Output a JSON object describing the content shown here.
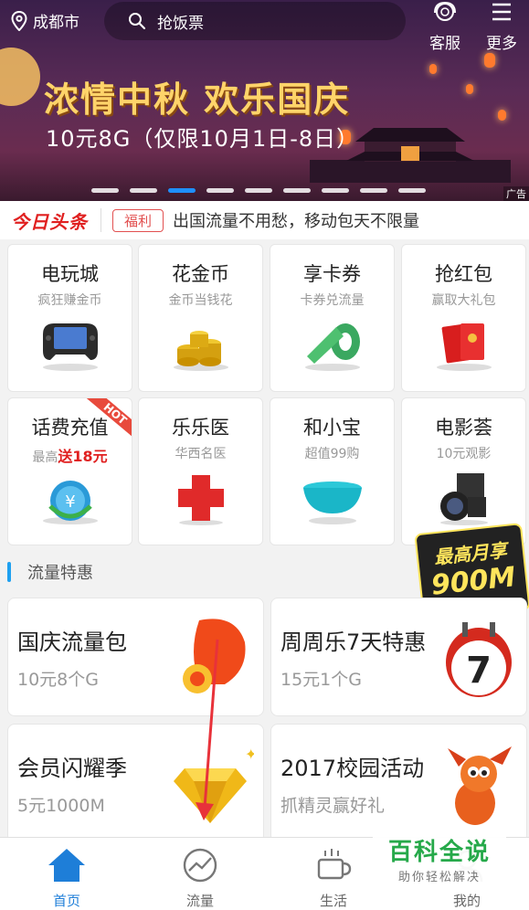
{
  "header": {
    "location": "成都市",
    "search_placeholder": "抢饭票",
    "service_label": "客服",
    "more_label": "更多"
  },
  "banner": {
    "title": "浓情中秋  欢乐国庆",
    "subtitle": "10元8G（仅限10月1日-8日）",
    "ad_label": "广告",
    "page_count": 9,
    "active_index": 2
  },
  "news": {
    "source": "今日头条",
    "tag": "福利",
    "text": "出国流量不用愁，移动包天不限量"
  },
  "grid": [
    {
      "title": "电玩城",
      "sub": "疯狂赚金币",
      "icon": "gamepad-icon"
    },
    {
      "title": "花金币",
      "sub": "金币当钱花",
      "icon": "gold-coins-icon"
    },
    {
      "title": "享卡券",
      "sub": "卡券兑流量",
      "icon": "ticket-roll-icon"
    },
    {
      "title": "抢红包",
      "sub": "赢取大礼包",
      "icon": "red-envelope-icon"
    },
    {
      "title": "话费充值",
      "sub_prefix": "最高",
      "sub_highlight": "送18元",
      "icon": "phone-recharge-icon",
      "badge": "HOT"
    },
    {
      "title": "乐乐医",
      "sub": "华西名医",
      "icon": "red-cross-icon"
    },
    {
      "title": "和小宝",
      "sub": "超值99购",
      "icon": "bowl-icon"
    },
    {
      "title": "电影荟",
      "sub": "10元观影",
      "icon": "camera-icon"
    }
  ],
  "section": {
    "title": "流量特惠",
    "promo_line1": "最高月享",
    "promo_line2": "900M"
  },
  "cards": [
    {
      "title": "国庆流量包",
      "sub": "10元8个G",
      "icon": "lantern-icon"
    },
    {
      "title": "周周乐7天特惠",
      "sub": "15元1个G",
      "icon": "calendar-icon"
    },
    {
      "title": "会员闪耀季",
      "sub": "5元1000M",
      "icon": "diamond-icon"
    },
    {
      "title": "2017校园活动",
      "sub": "抓精灵赢好礼",
      "icon": "dragon-icon"
    }
  ],
  "nav": [
    {
      "label": "首页",
      "icon": "home-icon",
      "active": true
    },
    {
      "label": "流量",
      "icon": "traffic-icon",
      "active": false
    },
    {
      "label": "生活",
      "icon": "cup-icon",
      "active": false
    },
    {
      "label": "我的",
      "icon": "user-icon",
      "active": false
    }
  ],
  "watermark": {
    "title": "百科全说",
    "sub": "助你轻松解决"
  },
  "colors": {
    "accent": "#1e7ed8",
    "red": "#e02020",
    "banner_gold": "#ffd46a"
  }
}
